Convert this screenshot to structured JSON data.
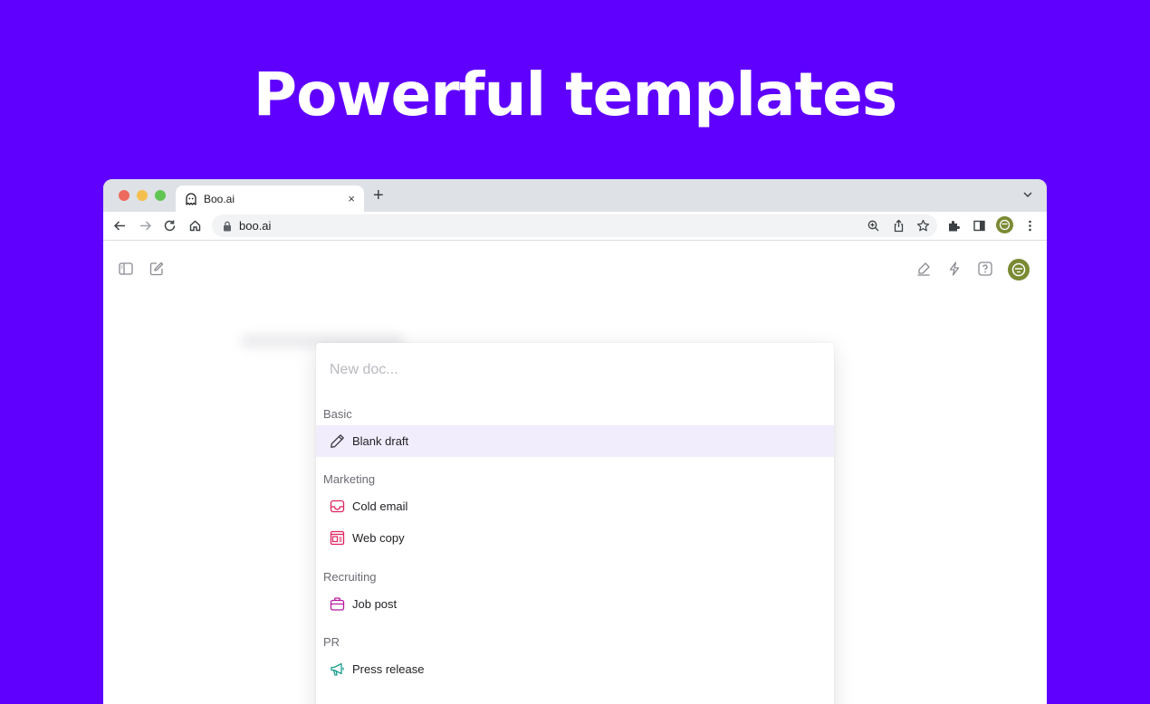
{
  "hero": {
    "title": "Powerful templates"
  },
  "browser": {
    "tab_title": "Boo.ai",
    "tab_close": "×",
    "new_tab": "+",
    "url": "boo.ai"
  },
  "panel": {
    "search_placeholder": "New doc...",
    "sections": [
      {
        "label": "Basic",
        "items": [
          {
            "label": "Blank draft",
            "icon": "pencil-icon",
            "selected": true
          }
        ]
      },
      {
        "label": "Marketing",
        "items": [
          {
            "label": "Cold email",
            "icon": "inbox-icon"
          },
          {
            "label": "Web copy",
            "icon": "webpage-icon"
          }
        ]
      },
      {
        "label": "Recruiting",
        "items": [
          {
            "label": "Job post",
            "icon": "briefcase-icon"
          }
        ]
      },
      {
        "label": "PR",
        "items": [
          {
            "label": "Press release",
            "icon": "megaphone-icon"
          }
        ]
      }
    ]
  },
  "colors": {
    "background": "#5f00ff",
    "selected_row": "#f1edfd",
    "marketing_icon": "#e0245e",
    "recruiting_icon": "#b5179e",
    "pr_icon": "#1a9e8f",
    "avatar": "#7a8a33"
  }
}
